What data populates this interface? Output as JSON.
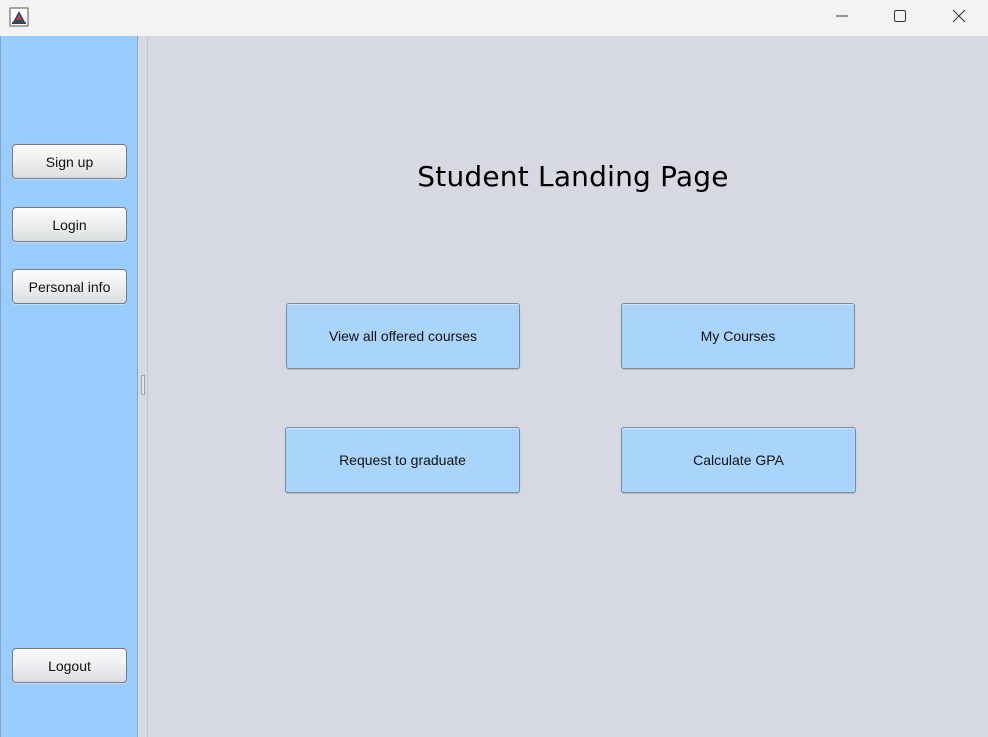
{
  "window": {
    "app_icon": "java-app-icon",
    "controls": {
      "minimize_icon": "minimize-icon",
      "maximize_icon": "maximize-icon",
      "close_icon": "close-icon"
    }
  },
  "sidebar": {
    "sign_up_label": "Sign up",
    "login_label": "Login",
    "personal_info_label": "Personal info",
    "logout_label": "Logout"
  },
  "main": {
    "title": "Student Landing Page",
    "view_courses_label": "View all offered courses",
    "my_courses_label": "My Courses",
    "request_graduate_label": "Request to graduate",
    "calculate_gpa_label": "Calculate GPA"
  },
  "colors": {
    "sidebar_bg": "#99ccff",
    "main_bg": "#d6d9e1",
    "action_button_bg": "#a9d5fc",
    "titlebar_bg": "#f3f3f3"
  }
}
